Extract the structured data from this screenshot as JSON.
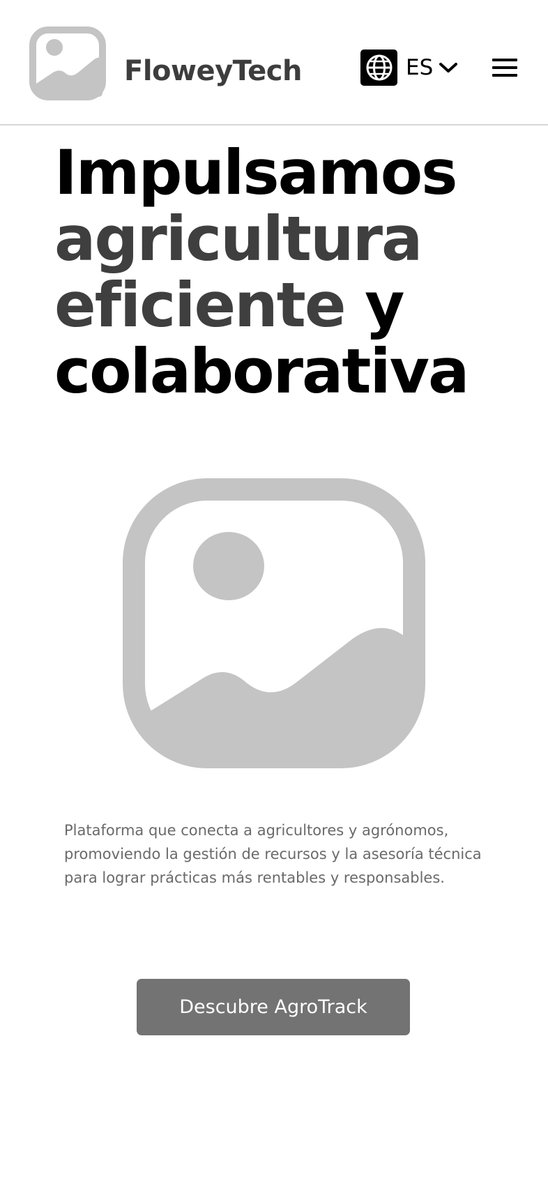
{
  "header": {
    "brand": "FloweyTech",
    "logo_icon": "image-placeholder-icon",
    "language": {
      "code": "ES",
      "icon": "globe-icon",
      "chevron_icon": "chevron-down-icon"
    },
    "menu_icon": "hamburger-menu-icon"
  },
  "hero": {
    "title_line1": "Impulsamos",
    "title_line2": "agricultura",
    "title_line3_gray": "eficiente",
    "title_line3_dark": " y",
    "title_line4": "colaborativa",
    "image_icon": "image-placeholder-icon",
    "description": "Plataforma que conecta a agricultores y agrónomos, promoviendo la gestión de recursos y la asesoría técnica para lograr prácticas más rentables y responsables.",
    "cta_label": "Descubre AgroTrack"
  },
  "colors": {
    "title_dark": "#000000",
    "title_gray": "#3f3f3f",
    "placeholder": "#c4c4c4",
    "button_bg": "#737373",
    "body_text": "#6a6a6a"
  }
}
